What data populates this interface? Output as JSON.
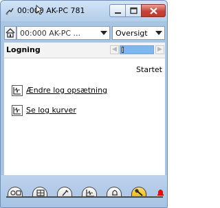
{
  "window": {
    "title": "00:000 AK-PC 781",
    "minimize_icon": "minimize-icon",
    "maximize_icon": "maximize-icon",
    "close_icon": "close-icon"
  },
  "toolbar": {
    "home_icon": "home-icon",
    "device_value": "00:000 AK-PC ...",
    "view_value": "Oversigt"
  },
  "panel": {
    "title": "Logning",
    "status": "Startet",
    "links": [
      {
        "label": "Ændre log opsætning",
        "icon": "graph-icon"
      },
      {
        "label": "Se log kurver",
        "icon": "graph-icon"
      }
    ]
  },
  "tabs": [
    {
      "icon": "controller-icon",
      "active": false
    },
    {
      "icon": "grid-icon",
      "active": false
    },
    {
      "icon": "tools-icon",
      "active": false
    },
    {
      "icon": "graph-icon",
      "active": false
    },
    {
      "icon": "bell-icon",
      "active": false
    },
    {
      "icon": "wrench-icon",
      "active": true
    }
  ],
  "colors": {
    "active_tab": "#f2b200",
    "alarm": "#e01010",
    "pager_fill": "#7eb7f0"
  }
}
